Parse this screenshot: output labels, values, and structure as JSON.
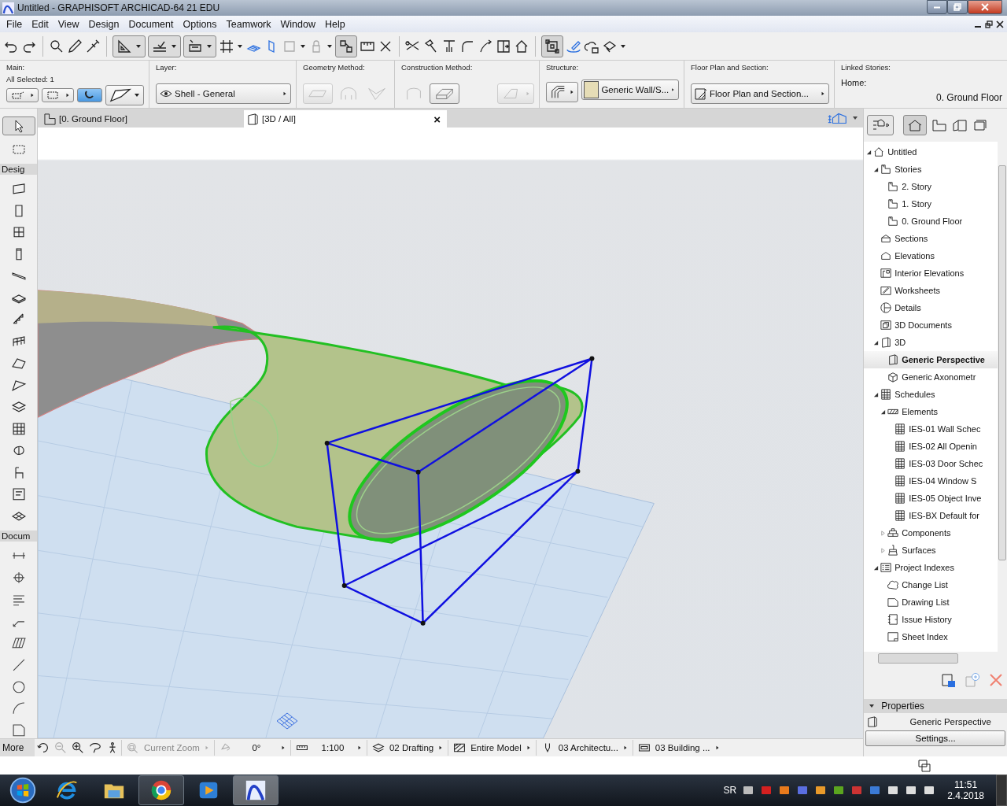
{
  "window": {
    "title": "Untitled - GRAPHISOFT ARCHICAD-64 21 EDU"
  },
  "menu": [
    "File",
    "Edit",
    "View",
    "Design",
    "Document",
    "Options",
    "Teamwork",
    "Window",
    "Help"
  ],
  "info_box": {
    "main": {
      "label": "Main:",
      "selection": "All Selected: 1"
    },
    "layer": {
      "label": "Layer:",
      "value": "Shell - General"
    },
    "geometry_method": {
      "label": "Geometry Method:"
    },
    "construction_method": {
      "label": "Construction Method:"
    },
    "structure": {
      "label": "Structure:",
      "value": "Generic Wall/S..."
    },
    "floor_plan": {
      "label": "Floor Plan and Section:",
      "value": "Floor Plan and Section..."
    },
    "linked_stories": {
      "label": "Linked Stories:",
      "home_label": "Home:",
      "home_value": "0. Ground Floor"
    }
  },
  "tabs": [
    {
      "label": "[0. Ground Floor]",
      "selected": false
    },
    {
      "label": "[3D / All]",
      "selected": true,
      "close": "×"
    }
  ],
  "toolbox": {
    "sections": [
      "Desig",
      "Docum"
    ]
  },
  "navigator": {
    "tree": [
      {
        "label": "Untitled",
        "kind": "project",
        "expanded": true,
        "selected": false,
        "children": [
          {
            "label": "Stories",
            "kind": "stories",
            "expanded": true,
            "selected": false,
            "children": [
              {
                "label": "2. Story",
                "kind": "story",
                "selected": false
              },
              {
                "label": "1. Story",
                "kind": "story",
                "selected": false
              },
              {
                "label": "0. Ground Floor",
                "kind": "story",
                "selected": false
              }
            ]
          },
          {
            "label": "Sections",
            "kind": "sections",
            "selected": false
          },
          {
            "label": "Elevations",
            "kind": "elevations",
            "selected": false
          },
          {
            "label": "Interior Elevations",
            "kind": "interior",
            "selected": false
          },
          {
            "label": "Worksheets",
            "kind": "worksheets",
            "selected": false
          },
          {
            "label": "Details",
            "kind": "details",
            "selected": false
          },
          {
            "label": "3D Documents",
            "kind": "documents",
            "selected": false
          },
          {
            "label": "3D",
            "kind": "view3d",
            "expanded": true,
            "selected": false,
            "children": [
              {
                "label": "Generic Perspective",
                "kind": "perspective",
                "selected": true
              },
              {
                "label": "Generic Axonometr",
                "kind": "axonometry",
                "selected": false
              }
            ]
          },
          {
            "label": "Schedules",
            "kind": "schedules",
            "expanded": true,
            "selected": false,
            "children": [
              {
                "label": "Elements",
                "kind": "elements",
                "expanded": true,
                "selected": false,
                "children": [
                  {
                    "label": "IES-01 Wall Schec",
                    "kind": "schedule",
                    "selected": false
                  },
                  {
                    "label": "IES-02 All Openin",
                    "kind": "schedule",
                    "selected": false
                  },
                  {
                    "label": "IES-03 Door Schec",
                    "kind": "schedule",
                    "selected": false
                  },
                  {
                    "label": "IES-04 Window S",
                    "kind": "schedule",
                    "selected": false
                  },
                  {
                    "label": "IES-05 Object Inve",
                    "kind": "schedule",
                    "selected": false
                  },
                  {
                    "label": "IES-BX Default for",
                    "kind": "schedule",
                    "selected": false
                  }
                ]
              },
              {
                "label": "Components",
                "kind": "components",
                "expanded": false,
                "selected": false
              },
              {
                "label": "Surfaces",
                "kind": "surfaces",
                "expanded": false,
                "selected": false
              }
            ]
          },
          {
            "label": "Project Indexes",
            "kind": "indexes",
            "expanded": true,
            "selected": false,
            "children": [
              {
                "label": "Change List",
                "kind": "changes",
                "selected": false
              },
              {
                "label": "Drawing List",
                "kind": "drawings",
                "selected": false
              },
              {
                "label": "Issue History",
                "kind": "issues",
                "selected": false
              },
              {
                "label": "Sheet Index",
                "kind": "sheets",
                "selected": false
              }
            ]
          }
        ]
      }
    ],
    "properties": {
      "title": "Properties",
      "value": "Generic Perspective",
      "button": "Settings..."
    }
  },
  "status_bar": {
    "more": "More",
    "items": [
      {
        "label": "Current Zoom",
        "disabled": true
      },
      {
        "label": "0°",
        "disabled": false
      },
      {
        "label": "1:100",
        "disabled": false
      },
      {
        "label": "02 Drafting",
        "disabled": false
      },
      {
        "label": "Entire Model",
        "disabled": false
      },
      {
        "label": "03 Architectu...",
        "disabled": false
      },
      {
        "label": "03 Building ...",
        "disabled": false
      }
    ]
  },
  "taskbar": {
    "apps": [
      {
        "open": false,
        "selected": false
      },
      {
        "open": false,
        "selected": false
      },
      {
        "open": true,
        "selected": false
      },
      {
        "open": false,
        "selected": false
      },
      {
        "open": true,
        "selected": true
      }
    ],
    "language": "SR",
    "time": "11:51",
    "date": "2.4.2018"
  }
}
